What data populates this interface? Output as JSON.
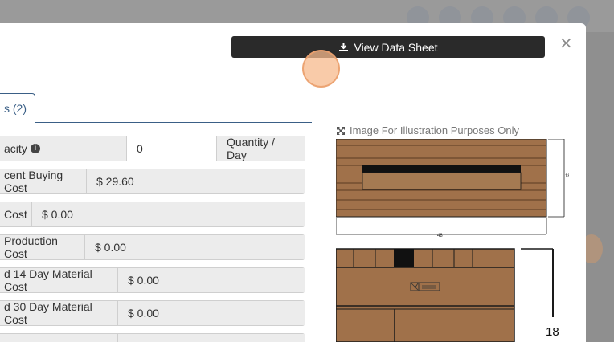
{
  "modal": {
    "view_sheet_label": "View Data Sheet",
    "close_glyph": "×",
    "tab_label": "s (2)"
  },
  "rows": [
    {
      "label": "acity",
      "has_info": true,
      "input_value": "0",
      "addon": "Quantity / Day"
    },
    {
      "label": "cent Buying Cost",
      "value": "$ 29.60"
    },
    {
      "label": "Cost",
      "value": "$ 0.00"
    },
    {
      "label": "Production Cost",
      "value": "$ 0.00"
    },
    {
      "label": "d 14 Day Material Cost",
      "value": "$ 0.00"
    },
    {
      "label": "d 30 Day Material Cost",
      "value": "$ 0.00"
    }
  ],
  "illustration": {
    "caption": "Image For Illustration Purposes Only",
    "top_view": {
      "width_label": "48",
      "height_label": "18"
    },
    "side_view": {
      "height_label": "18"
    },
    "colors": {
      "wood": "#a0714a",
      "wood_dark": "#8a5e3b",
      "line": "#1a1a1a"
    }
  },
  "icons": {
    "download": "download-icon",
    "expand": "expand-icon",
    "close": "close-icon",
    "info": "info-icon"
  }
}
